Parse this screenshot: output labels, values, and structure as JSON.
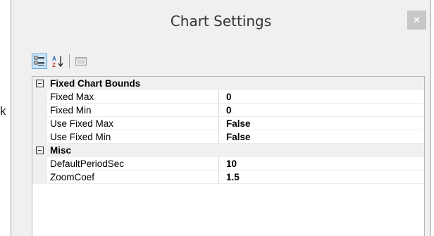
{
  "stray_text": "k",
  "window": {
    "title": "Chart Settings",
    "close_glyph": "×"
  },
  "toolbar": {
    "categorized_tooltip": "Categorized",
    "alphabetical_tooltip": "Alphabetical",
    "pages_tooltip": "Property Pages",
    "active": "categorized"
  },
  "grid": {
    "categories": [
      {
        "name": "Fixed Chart Bounds",
        "properties": [
          {
            "name": "Fixed Max",
            "value": "0"
          },
          {
            "name": "Fixed Min",
            "value": "0"
          },
          {
            "name": "Use Fixed Max",
            "value": "False"
          },
          {
            "name": "Use Fixed Min",
            "value": "False"
          }
        ]
      },
      {
        "name": "Misc",
        "properties": [
          {
            "name": "DefaultPeriodSec",
            "value": "10"
          },
          {
            "name": "ZoomCoef",
            "value": "1.5"
          }
        ]
      }
    ]
  },
  "colors": {
    "window_bg": "#f0f0f0",
    "close_bg": "#c7c7c7",
    "active_tool_bg": "#cde6f7",
    "active_tool_border": "#5aa0d8"
  }
}
